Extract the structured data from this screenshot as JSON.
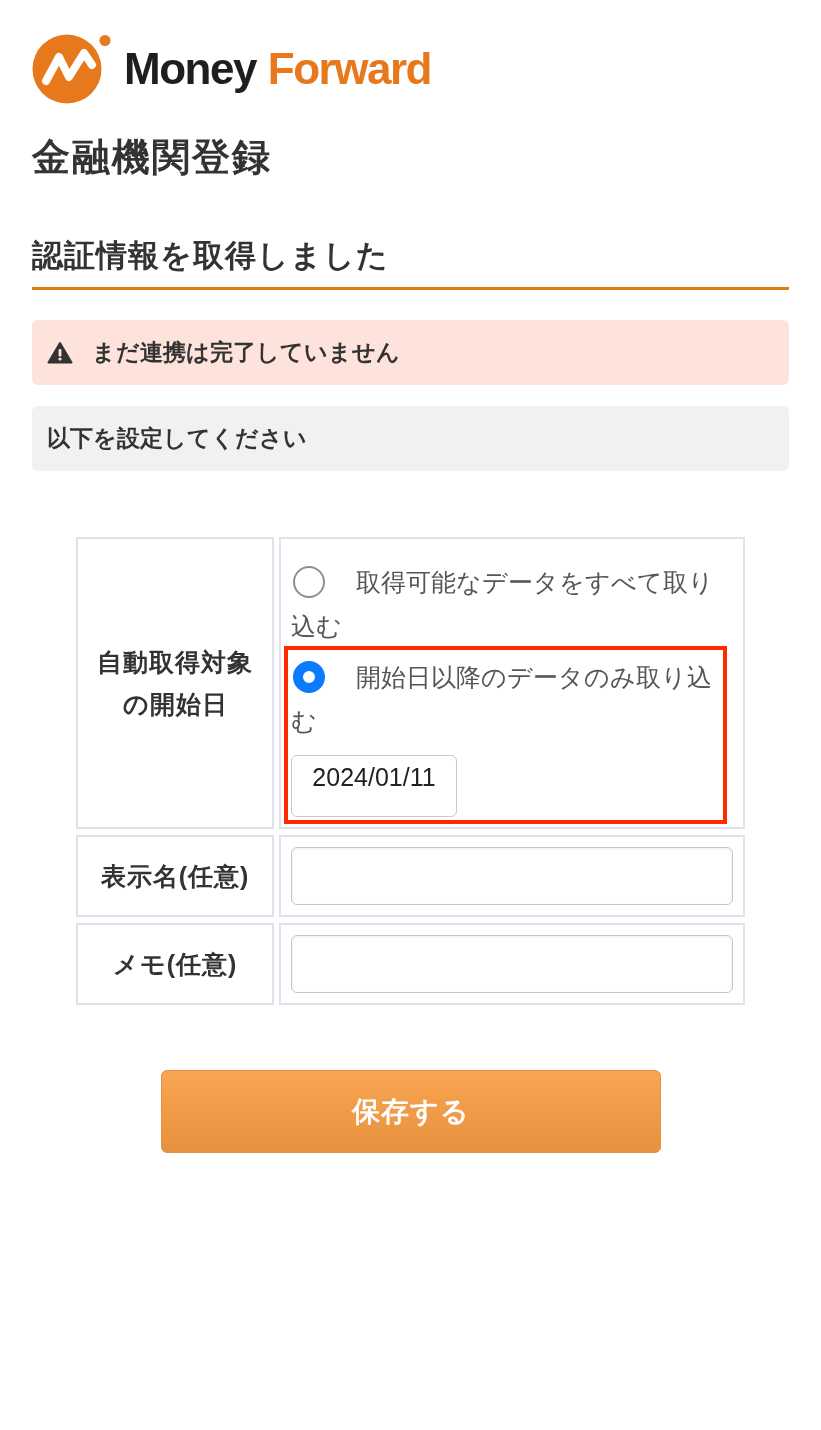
{
  "logo": {
    "text": "Money",
    "accent_text": "Forward"
  },
  "page_title": "金融機関登録",
  "section_title": "認証情報を取得しました",
  "notices": [
    {
      "kind": "warning",
      "text": "まだ連携は完了していません"
    },
    {
      "kind": "info",
      "text": "以下を設定してください"
    }
  ],
  "form": {
    "rows": [
      {
        "kind": "radio_group",
        "label": "自動取得対象の開始日",
        "options": [
          {
            "label": "取得可能なデータをすべて取り込む",
            "selected": false,
            "highlighted": false
          },
          {
            "label": "開始日以降のデータのみ取り込む",
            "selected": true,
            "highlighted": true,
            "date_field": {
              "value": "2024/01/11"
            }
          }
        ]
      },
      {
        "kind": "text_input",
        "label": "表示名(任意)"
      },
      {
        "kind": "text_input",
        "label": "メモ(任意)"
      }
    ]
  },
  "submit_button": "保存する"
}
